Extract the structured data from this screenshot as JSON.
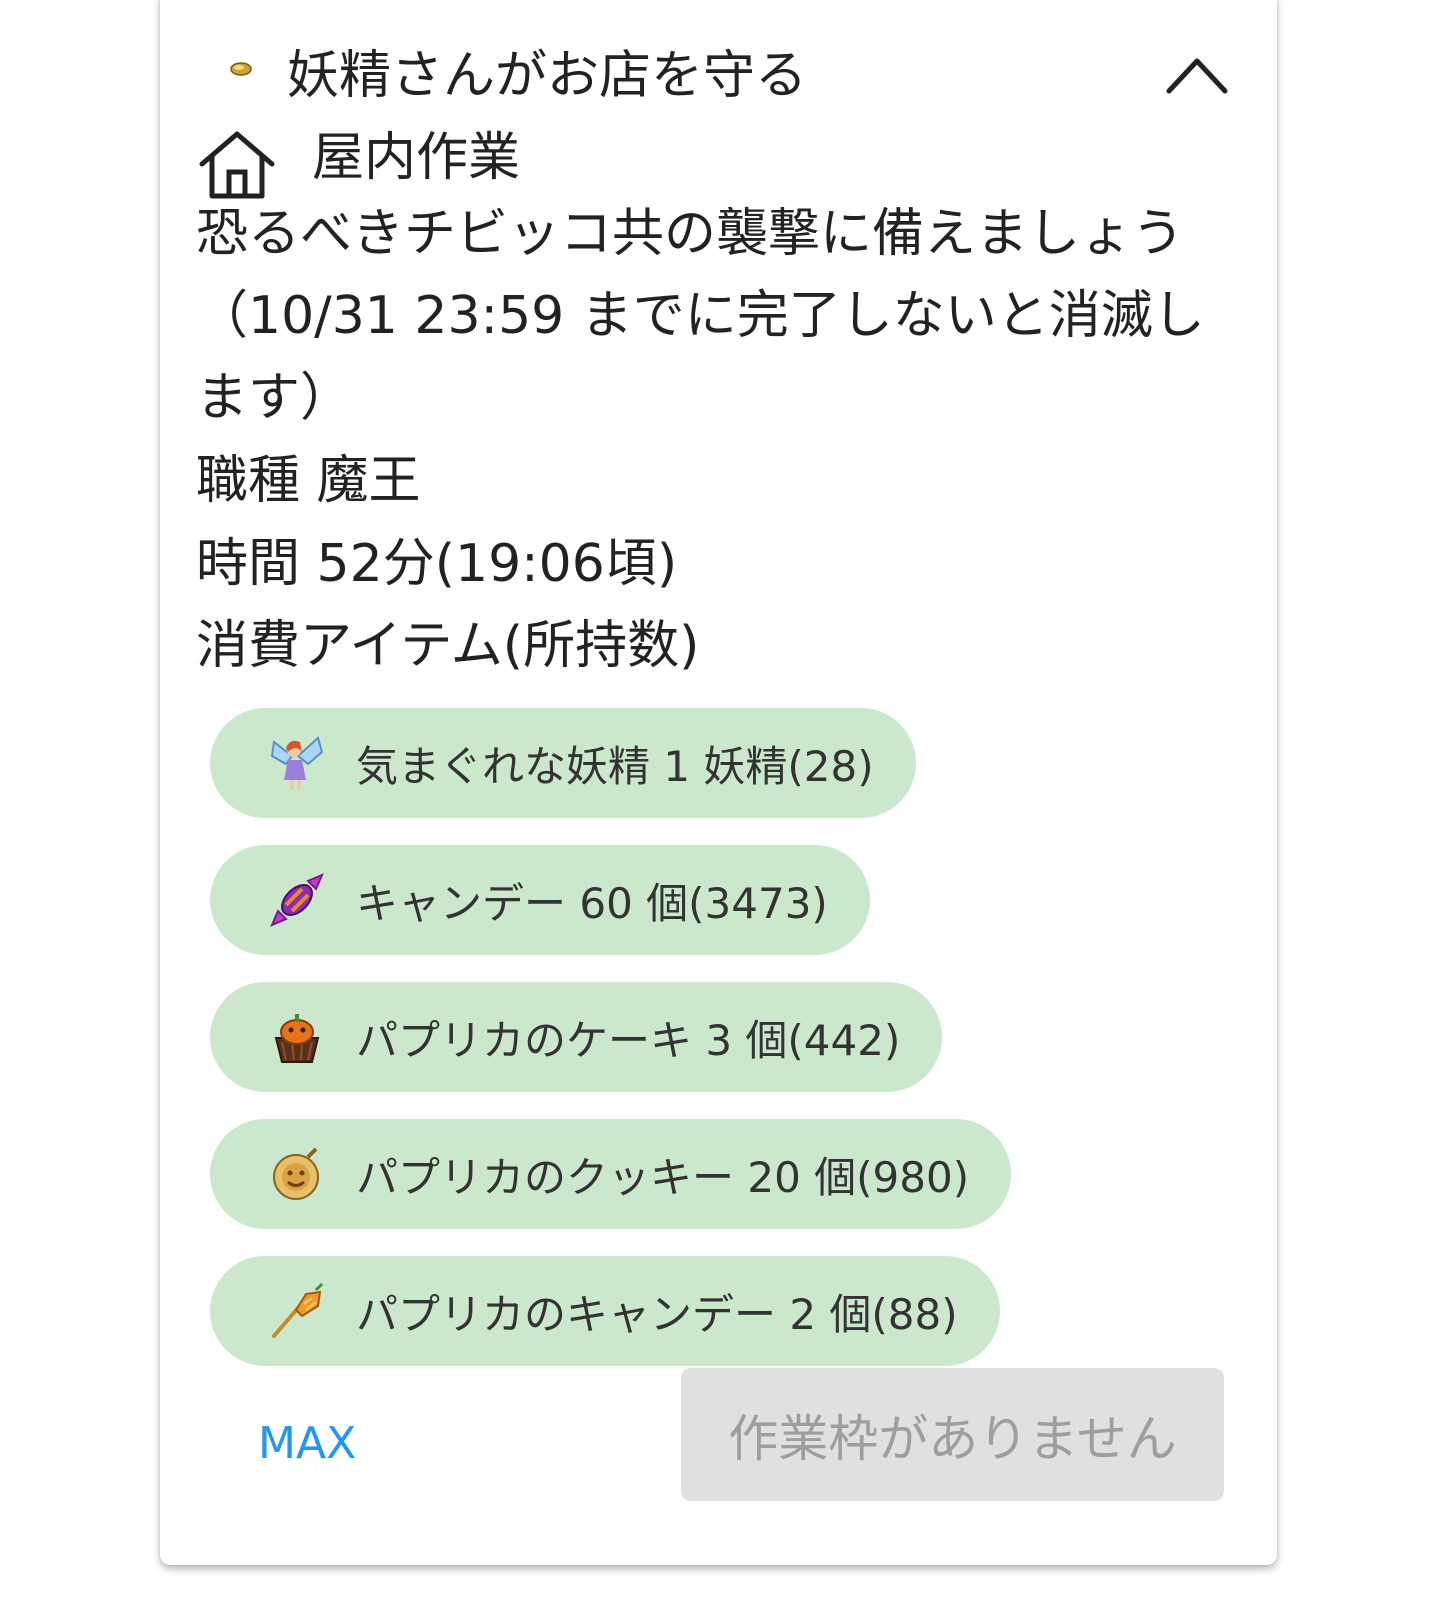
{
  "task": {
    "icon": "gold-nugget-icon",
    "title": "妖精さんがお店を守る",
    "collapse_icon": "chevron-up-icon"
  },
  "category": {
    "icon": "house-icon",
    "label": "屋内作業"
  },
  "description": "恐るべきチビッコ共の襲撃に備えましょう（10/31 23:59 までに完了しないと消滅します）",
  "job": "職種 魔王",
  "time": "時間 52分(19:06頃)",
  "consume_label": "消費アイテム(所持数)",
  "items": [
    {
      "icon": "fairy-icon",
      "label": "気まぐれな妖精 1 妖精(28)"
    },
    {
      "icon": "candy-icon",
      "label": "キャンデー 60 個(3473)"
    },
    {
      "icon": "paprika-cake-icon",
      "label": "パプリカのケーキ 3 個(442)"
    },
    {
      "icon": "paprika-cookie-icon",
      "label": "パプリカのクッキー 20 個(980)"
    },
    {
      "icon": "paprika-candy-icon",
      "label": "パプリカのキャンデー 2 個(88)"
    }
  ],
  "max_label": "MAX",
  "submit_label": "作業枠がありません",
  "colors": {
    "pill_bg": "#cbe8cd",
    "max_link": "#2196f3",
    "disabled_bg": "#e0e0e0",
    "disabled_text": "#9e9e9e"
  }
}
